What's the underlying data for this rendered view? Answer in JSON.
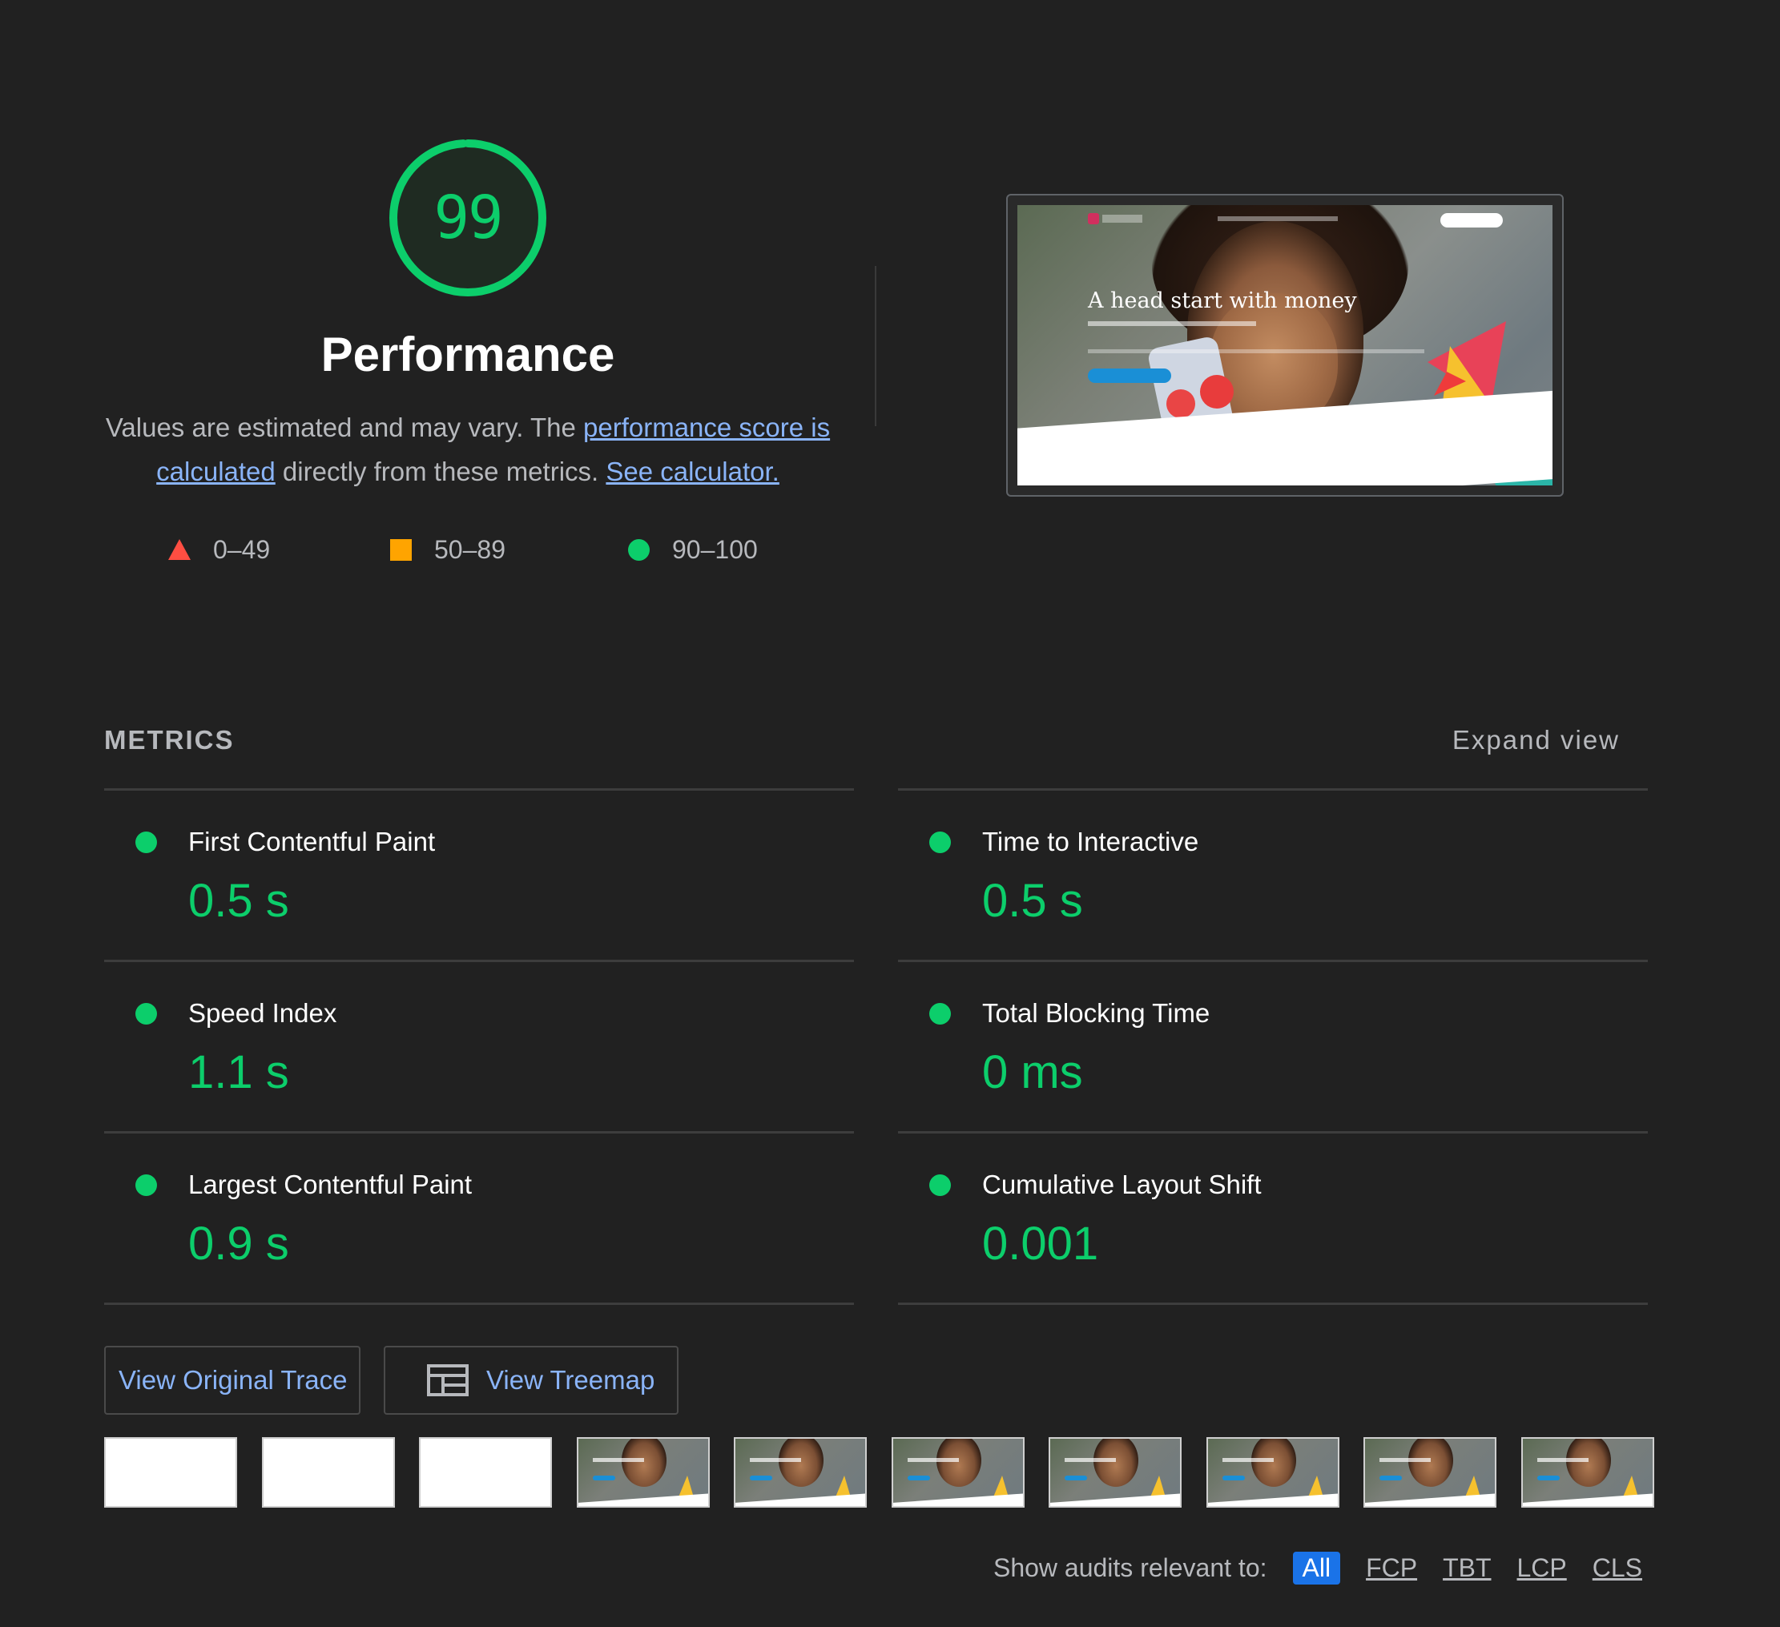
{
  "score": {
    "value": "99",
    "fraction": 0.99,
    "color": "#0cce6b"
  },
  "category": {
    "title": "Performance",
    "description_prefix": "Values are estimated and may vary. The ",
    "link_score": "performance score is calculated",
    "description_middle": " directly from these metrics. ",
    "link_calculator": "See calculator."
  },
  "scale": {
    "fail": {
      "label": "0–49",
      "color": "#ff4e42",
      "icon": "red-triangle"
    },
    "average": {
      "label": "50–89",
      "color": "#ffa400",
      "icon": "orange-square"
    },
    "pass": {
      "label": "90–100",
      "color": "#0cce6b",
      "icon": "green-circle"
    }
  },
  "final_screenshot": {
    "heading": "A head start with money"
  },
  "metrics": {
    "header": "METRICS",
    "expand": "Expand view",
    "left": [
      {
        "title": "First Contentful Paint",
        "value": "0.5 s"
      },
      {
        "title": "Speed Index",
        "value": "1.1 s"
      },
      {
        "title": "Largest Contentful Paint",
        "value": "0.9 s"
      }
    ],
    "right": [
      {
        "title": "Time to Interactive",
        "value": "0.5 s"
      },
      {
        "title": "Total Blocking Time",
        "value": "0 ms"
      },
      {
        "title": "Cumulative Layout Shift",
        "value": "0.001"
      }
    ]
  },
  "buttons": {
    "trace": "View Original Trace",
    "treemap": "View Treemap",
    "treemap_icon": "treemap-icon"
  },
  "filmstrip": {
    "frames": [
      "blank",
      "blank",
      "blank",
      "loaded",
      "loaded",
      "loaded",
      "loaded",
      "loaded",
      "loaded",
      "loaded"
    ]
  },
  "audit_filter": {
    "label": "Show audits relevant to:",
    "chips": [
      "All",
      "FCP",
      "TBT",
      "LCP",
      "CLS"
    ],
    "active": "All",
    "active_color": "#1a73e8"
  }
}
